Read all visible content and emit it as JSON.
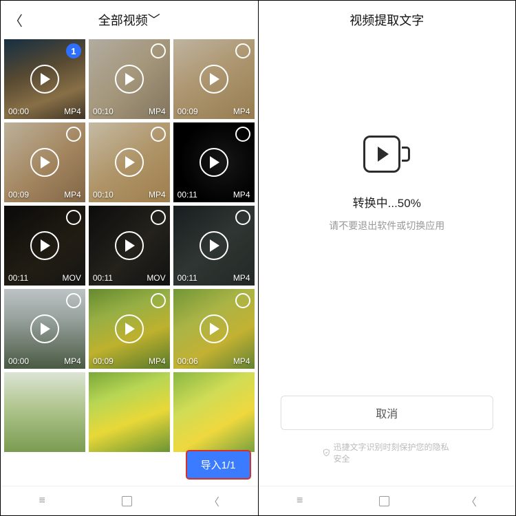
{
  "left": {
    "title": "全部视频",
    "import_label": "导入1/1",
    "videos": [
      {
        "dur": "00:00",
        "fmt": "MP4",
        "selected": true,
        "sel_label": "1"
      },
      {
        "dur": "00:10",
        "fmt": "MP4",
        "selected": false
      },
      {
        "dur": "00:09",
        "fmt": "MP4",
        "selected": false
      },
      {
        "dur": "00:09",
        "fmt": "MP4",
        "selected": false
      },
      {
        "dur": "00:10",
        "fmt": "MP4",
        "selected": false
      },
      {
        "dur": "00:11",
        "fmt": "MP4",
        "selected": false
      },
      {
        "dur": "00:11",
        "fmt": "MOV",
        "selected": false
      },
      {
        "dur": "00:11",
        "fmt": "MOV",
        "selected": false
      },
      {
        "dur": "00:11",
        "fmt": "MP4",
        "selected": false
      },
      {
        "dur": "00:00",
        "fmt": "MP4",
        "selected": false
      },
      {
        "dur": "00:09",
        "fmt": "MP4",
        "selected": false
      },
      {
        "dur": "00:06",
        "fmt": "MP4",
        "selected": false
      }
    ]
  },
  "right": {
    "title": "视频提取文字",
    "status": "转换中...50%",
    "hint": "请不要退出软件或切换应用",
    "cancel_label": "取消",
    "privacy": "迅捷文字识别时刻保护您的隐私安全"
  }
}
